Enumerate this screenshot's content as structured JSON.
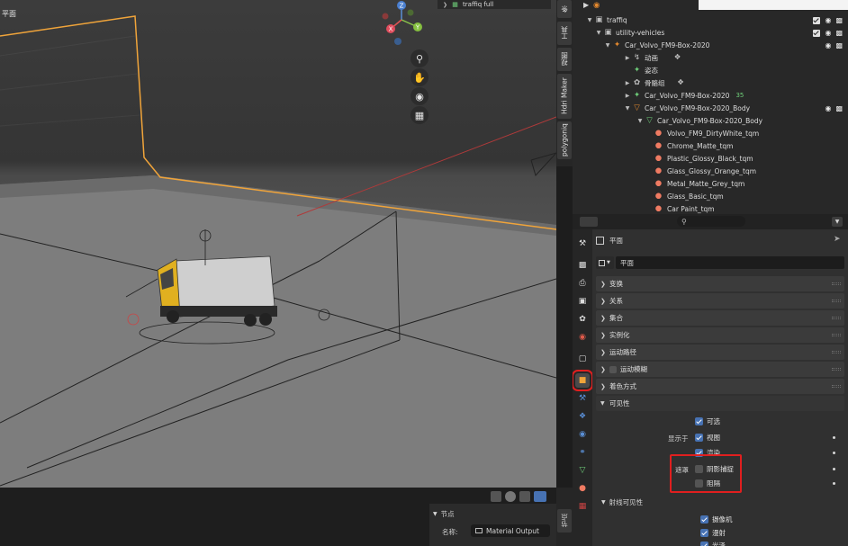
{
  "viewport": {
    "label": "平面",
    "gizmo": {
      "z": "Z",
      "y": "Y",
      "x": "X"
    },
    "tools": [
      "zoom-icon",
      "hand-pan-icon",
      "camera-icon",
      "grid-icon"
    ],
    "header_icons": [
      "viewport-shading-icon",
      "overlay-icon",
      "gizmo-toggle-icon"
    ]
  },
  "side_tabs": [
    "工具",
    "视图",
    "Hdri Maker",
    "polygoniq"
  ],
  "side_tab_top": "条",
  "outliner": {
    "top_item": "traffiq full",
    "rows": [
      {
        "label": "traffiq",
        "type": "collection"
      },
      {
        "label": "utility-vehicles",
        "type": "collection"
      },
      {
        "label": "Car_Volvo_FM9-Box-2020",
        "type": "armature"
      },
      {
        "label": "动画",
        "type": "anim"
      },
      {
        "label": "姿态",
        "type": "pose"
      },
      {
        "label": "骨骼组",
        "type": "bonegroup"
      },
      {
        "label": "Car_Volvo_FM9-Box-2020",
        "type": "armature-data"
      },
      {
        "label": "Car_Volvo_FM9-Box-2020_Body",
        "type": "mesh-object"
      },
      {
        "label": "Car_Volvo_FM9-Box-2020_Body",
        "type": "mesh-data"
      },
      {
        "label": "Volvo_FM9_DirtyWhite_tqm",
        "type": "material"
      },
      {
        "label": "Chrome_Matte_tqm",
        "type": "material"
      },
      {
        "label": "Plastic_Glossy_Black_tqm",
        "type": "material"
      },
      {
        "label": "Glass_Glossy_Orange_tqm",
        "type": "material"
      },
      {
        "label": "Metal_Matte_Grey_tqm",
        "type": "material"
      },
      {
        "label": "Glass_Basic_tqm",
        "type": "material"
      },
      {
        "label": "Car Paint_tqm",
        "type": "material"
      }
    ],
    "badge_35": "35"
  },
  "properties": {
    "object_name": "平面",
    "object_field": "平面",
    "panels": [
      "变换",
      "关系",
      "集合",
      "实例化",
      "运动路径",
      "运动模糊",
      "着色方式"
    ],
    "visibility": {
      "title": "可见性",
      "selectable": "可选",
      "show_in": "显示于",
      "viewport": "视图",
      "render": "渲染",
      "mask": "遮罩",
      "shadow_catcher": "阴影捕捉",
      "holdout": "阻隔",
      "ray_visibility": "射线可见性",
      "camera": "摄像机",
      "diffuse": "漫射",
      "glossy": "光泽"
    }
  },
  "node_panel": {
    "section": "节点",
    "name_label": "名称:",
    "name_value": "Material Output",
    "side_tab": "节点"
  },
  "colors": {
    "accent_blue": "#4772b3",
    "highlight_red": "#e01f1f",
    "selection_orange": "#f0a43a"
  }
}
